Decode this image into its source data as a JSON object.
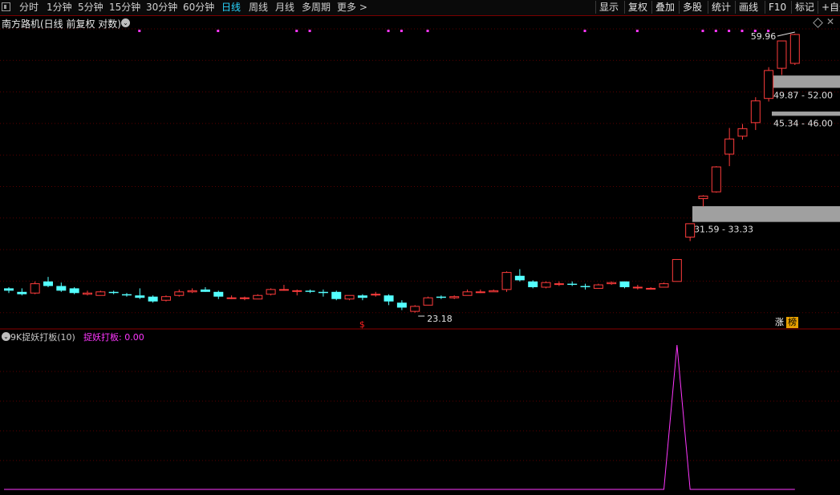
{
  "toolbar": {
    "tabs": [
      {
        "label": "分时",
        "active": false
      },
      {
        "label": "1分钟",
        "active": false
      },
      {
        "label": "5分钟",
        "active": false
      },
      {
        "label": "15分钟",
        "active": false
      },
      {
        "label": "30分钟",
        "active": false
      },
      {
        "label": "60分钟",
        "active": false
      },
      {
        "label": "日线",
        "active": true
      },
      {
        "label": "周线",
        "active": false
      },
      {
        "label": "月线",
        "active": false
      },
      {
        "label": "多周期",
        "active": false
      },
      {
        "label": "更多 >",
        "active": false
      }
    ],
    "buttons": [
      "显示",
      "复权",
      "叠加",
      "多股",
      "统计",
      "画线",
      "F10",
      "标记",
      "+自选"
    ]
  },
  "chart": {
    "title": "南方路机(日线 前复权 对数)",
    "colors": {
      "up": "#ff3c3c",
      "down": "#54ffff",
      "grid": "#5a0000",
      "zone": "#a0a0a0",
      "indicator": "#ff37ff",
      "signal": "#ff37ff"
    },
    "annotations": {
      "high_label": "59.96",
      "low_label": "23.18",
      "marker": "$"
    },
    "zones": [
      {
        "label": "49.87 - 52.00",
        "low": 49.87,
        "high": 52.0
      },
      {
        "label": "45.34 - 46.00",
        "low": 45.34,
        "high": 46.0
      },
      {
        "label": "31.59 - 33.33",
        "low": 31.59,
        "high": 33.33
      }
    ],
    "badges": [
      "涨",
      "榜"
    ]
  },
  "indicator": {
    "title": "9K捉妖打板(10)",
    "value_text": "捉妖打板: 0.00"
  },
  "chart_data": {
    "type": "candlestick",
    "title": "南方路机(日线 前复权 对数)",
    "y_scale": "log",
    "ohlc": [
      [
        25.2,
        25.3,
        24.8,
        25.0
      ],
      [
        24.9,
        25.2,
        24.6,
        24.7
      ],
      [
        24.8,
        25.8,
        24.7,
        25.6
      ],
      [
        25.8,
        26.2,
        25.3,
        25.4
      ],
      [
        25.4,
        25.7,
        24.9,
        25.0
      ],
      [
        25.2,
        25.3,
        24.7,
        24.8
      ],
      [
        24.7,
        25.0,
        24.6,
        24.8
      ],
      [
        24.6,
        25.0,
        24.6,
        24.9
      ],
      [
        24.9,
        25.0,
        24.7,
        24.8
      ],
      [
        24.7,
        24.8,
        24.5,
        24.6
      ],
      [
        24.6,
        25.2,
        24.3,
        24.4
      ],
      [
        24.5,
        24.6,
        24.0,
        24.1
      ],
      [
        24.2,
        24.6,
        24.1,
        24.5
      ],
      [
        24.6,
        25.1,
        24.5,
        24.9
      ],
      [
        24.9,
        25.2,
        24.8,
        25.0
      ],
      [
        25.1,
        25.3,
        24.9,
        24.9
      ],
      [
        24.9,
        25.0,
        24.3,
        24.5
      ],
      [
        24.4,
        24.6,
        24.3,
        24.4
      ],
      [
        24.4,
        24.5,
        24.2,
        24.4
      ],
      [
        24.3,
        24.7,
        24.3,
        24.6
      ],
      [
        24.7,
        25.2,
        24.6,
        25.1
      ],
      [
        25.1,
        25.5,
        25.0,
        25.1
      ],
      [
        25.0,
        25.1,
        24.6,
        25.0
      ],
      [
        25.0,
        25.1,
        24.8,
        24.9
      ],
      [
        24.9,
        25.1,
        24.5,
        24.8
      ],
      [
        24.9,
        25.0,
        24.2,
        24.3
      ],
      [
        24.3,
        24.6,
        24.2,
        24.6
      ],
      [
        24.6,
        24.7,
        24.2,
        24.4
      ],
      [
        24.7,
        24.9,
        24.5,
        24.7
      ],
      [
        24.6,
        24.7,
        23.8,
        24.1
      ],
      [
        24.0,
        24.2,
        23.4,
        23.6
      ],
      [
        23.3,
        23.8,
        23.2,
        23.7
      ],
      [
        23.8,
        24.5,
        23.8,
        24.4
      ],
      [
        24.5,
        24.6,
        24.3,
        24.4
      ],
      [
        24.4,
        24.6,
        24.3,
        24.5
      ],
      [
        24.6,
        25.1,
        24.6,
        24.9
      ],
      [
        24.9,
        25.1,
        24.8,
        24.9
      ],
      [
        24.9,
        25.1,
        24.9,
        25.0
      ],
      [
        25.1,
        26.7,
        24.9,
        26.6
      ],
      [
        26.3,
        26.9,
        25.8,
        25.9
      ],
      [
        25.8,
        25.9,
        25.2,
        25.3
      ],
      [
        25.3,
        25.8,
        25.2,
        25.7
      ],
      [
        25.6,
        25.8,
        25.4,
        25.6
      ],
      [
        25.6,
        25.8,
        25.4,
        25.5
      ],
      [
        25.4,
        25.6,
        25.1,
        25.3
      ],
      [
        25.2,
        25.6,
        25.2,
        25.5
      ],
      [
        25.6,
        25.8,
        25.5,
        25.7
      ],
      [
        25.8,
        25.8,
        25.2,
        25.3
      ],
      [
        25.3,
        25.5,
        25.1,
        25.3
      ],
      [
        25.2,
        25.3,
        25.1,
        25.2
      ],
      [
        25.3,
        25.7,
        25.3,
        25.6
      ],
      [
        25.8,
        27.8,
        25.8,
        27.8
      ],
      [
        30.0,
        31.4,
        29.6,
        31.4
      ],
      [
        34.2,
        34.6,
        33.3,
        34.5
      ],
      [
        35.0,
        38.2,
        34.9,
        38.1
      ],
      [
        39.8,
        43.5,
        38.2,
        41.9
      ],
      [
        42.3,
        44.1,
        41.8,
        43.4
      ],
      [
        44.3,
        48.3,
        43.2,
        47.7
      ],
      [
        48.1,
        53.5,
        47.6,
        52.9
      ],
      [
        53.3,
        58.5,
        52.1,
        58.5
      ],
      [
        54.2,
        59.96,
        53.9,
        59.8
      ]
    ],
    "indicator_series": {
      "name": "捉妖打板",
      "values": [
        0,
        0,
        0,
        0,
        0,
        0,
        0,
        0,
        0,
        0,
        0,
        0,
        0,
        0,
        0,
        0,
        0,
        0,
        0,
        0,
        0,
        0,
        0,
        0,
        0,
        0,
        0,
        0,
        0,
        0,
        0,
        0,
        0,
        0,
        0,
        0,
        0,
        0,
        0,
        0,
        0,
        0,
        0,
        0,
        0,
        0,
        0,
        0,
        0,
        0,
        0,
        1,
        0,
        0,
        0,
        0,
        0,
        0,
        0,
        0,
        0
      ]
    },
    "signal_marks": [
      10,
      16,
      22,
      23,
      29,
      30,
      32,
      44,
      48,
      53,
      54,
      55,
      56,
      57,
      58
    ]
  }
}
